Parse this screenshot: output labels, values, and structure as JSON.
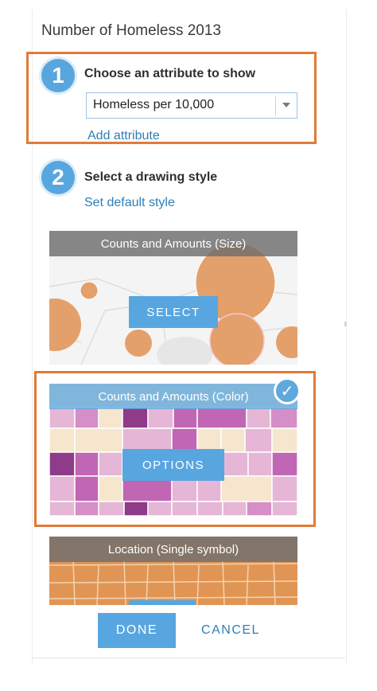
{
  "title": "Number of Homeless 2013",
  "step1": {
    "number": "1",
    "label": "Choose an attribute to show",
    "select_value": "Homeless per 10,000",
    "add_attribute": "Add attribute"
  },
  "step2": {
    "number": "2",
    "label": "Select a drawing style",
    "set_default": "Set default style"
  },
  "styles": [
    {
      "header": "Counts and Amounts (Size)",
      "button": "SELECT",
      "selected": false
    },
    {
      "header": "Counts and Amounts (Color)",
      "button": "OPTIONS",
      "selected": true
    },
    {
      "header": "Location (Single symbol)",
      "button": "",
      "selected": false
    }
  ],
  "footer": {
    "done": "DONE",
    "cancel": "CANCEL"
  },
  "colors": {
    "accent": "#58a6e0",
    "link": "#2c7fb8",
    "highlight": "#e07b39",
    "size_bubble": "#e3a06b",
    "single_symbol": "#e09554",
    "color_ramp": [
      "#f6e6cd",
      "#e5b6d6",
      "#d58ec7",
      "#c066b4",
      "#8e3b8a"
    ]
  }
}
